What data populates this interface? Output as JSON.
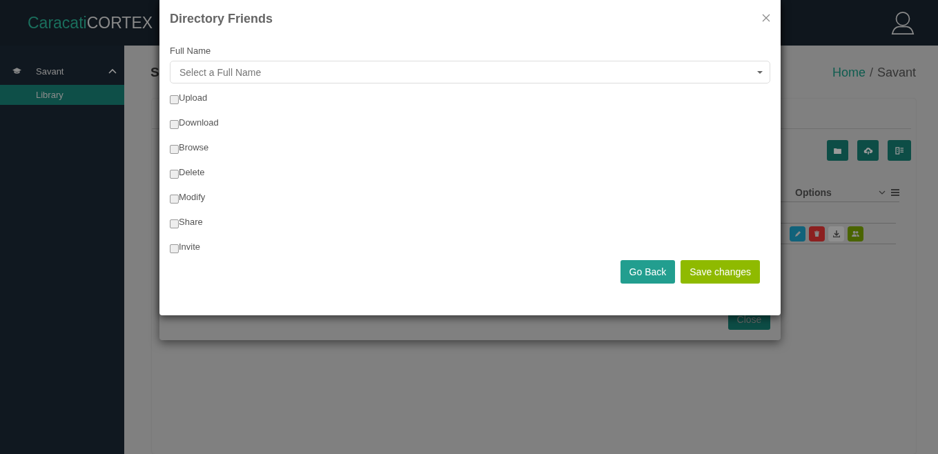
{
  "app": {
    "logo_primary": "Caracati",
    "logo_secondary": "CORTEX"
  },
  "sidebar": {
    "items": [
      {
        "label": "Savant",
        "expanded": true,
        "children": [
          {
            "label": "Library",
            "selected": true
          }
        ]
      }
    ]
  },
  "page": {
    "title": "S",
    "breadcrumb_separator": "/",
    "breadcrumb": [
      {
        "label": "Home",
        "link": true
      },
      {
        "label": "Savant",
        "link": false
      }
    ],
    "table": {
      "columns": [
        {
          "label": "Options"
        }
      ]
    }
  },
  "underlying_modal": {
    "buttons": [
      "Close"
    ]
  },
  "modal": {
    "title": "Directory Friends",
    "field": {
      "label": "Full Name",
      "placeholder": "Select a Full Name"
    },
    "permissions": [
      {
        "label": "Upload",
        "checked": false
      },
      {
        "label": "Download",
        "checked": false
      },
      {
        "label": "Browse",
        "checked": false
      },
      {
        "label": "Delete",
        "checked": false
      },
      {
        "label": "Modify",
        "checked": false
      },
      {
        "label": "Share",
        "checked": false
      },
      {
        "label": "Invite",
        "checked": false
      }
    ],
    "buttons": [
      {
        "label": "Go Back",
        "kind": "secondary"
      },
      {
        "label": "Save changes",
        "kind": "primary"
      }
    ]
  }
}
